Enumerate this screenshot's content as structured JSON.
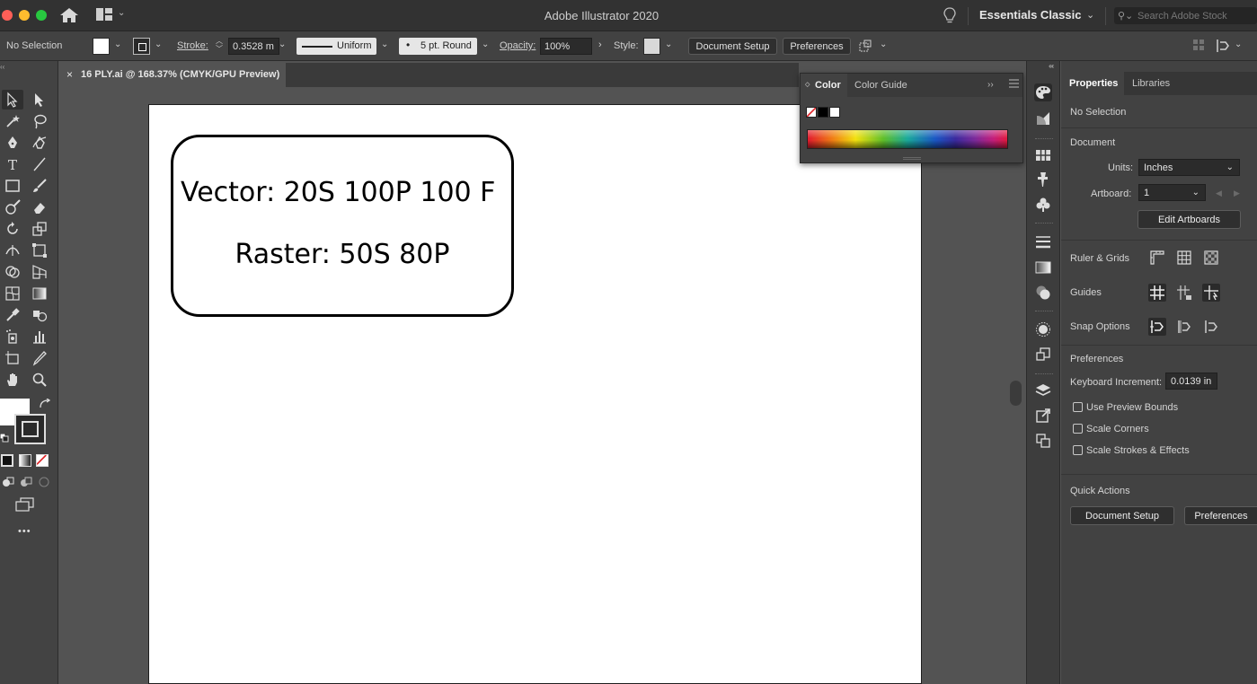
{
  "titlebar": {
    "app_title": "Adobe Illustrator 2020",
    "workspace": "Essentials Classic",
    "stock_search_placeholder": "Search Adobe Stock"
  },
  "controlbar": {
    "selection_status": "No Selection",
    "stroke_label": "Stroke:",
    "stroke_value": "0.3528 m",
    "profile": "Uniform",
    "brush": "5 pt. Round",
    "opacity_label": "Opacity:",
    "opacity_value": "100%",
    "style_label": "Style:",
    "document_setup": "Document Setup",
    "preferences": "Preferences"
  },
  "document": {
    "tab_title": "16 PLY.ai @ 168.37% (CMYK/GPU Preview)",
    "close_glyph": "×"
  },
  "artwork": {
    "line1": "Vector: 20S 100P 100 F",
    "line2": "Raster: 50S 80P"
  },
  "color_panel": {
    "tab_color": "Color",
    "tab_guide": "Color Guide",
    "more_glyph": "››"
  },
  "properties": {
    "tab_properties": "Properties",
    "tab_libraries": "Libraries",
    "selection_status": "No Selection",
    "document_heading": "Document",
    "units_label": "Units:",
    "units_value": "Inches",
    "artboard_label": "Artboard:",
    "artboard_value": "1",
    "edit_artboards": "Edit Artboards",
    "ruler_grids": "Ruler & Grids",
    "guides": "Guides",
    "snap_options": "Snap Options",
    "preferences_heading": "Preferences",
    "keyboard_increment_label": "Keyboard Increment:",
    "keyboard_increment_value": "0.0139 in",
    "use_preview_bounds": "Use Preview Bounds",
    "scale_corners": "Scale Corners",
    "scale_strokes": "Scale Strokes & Effects",
    "quick_actions": "Quick Actions",
    "qa_document_setup": "Document Setup",
    "qa_preferences": "Preferences"
  },
  "colors": {
    "ui_dark": "#323232",
    "ui_mid": "#424242",
    "canvas_bg": "#535353"
  },
  "toolbar": {
    "more_glyph": "•••",
    "collapse_glyph": "‹‹"
  }
}
